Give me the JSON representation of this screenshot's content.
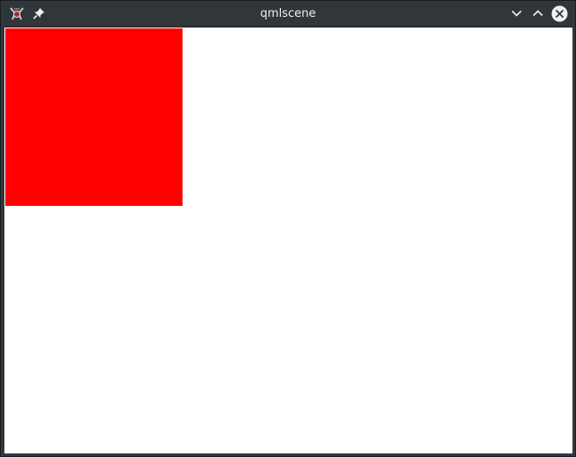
{
  "window": {
    "title": "qmlscene"
  },
  "icons": {
    "app": "qt-app-icon",
    "pin": "pin-icon",
    "minimize": "chevron-down-icon",
    "maximize": "chevron-up-icon",
    "close": "close-icon"
  },
  "scene": {
    "rectangle_color": "#ff0000",
    "background_color": "#ffffff"
  }
}
